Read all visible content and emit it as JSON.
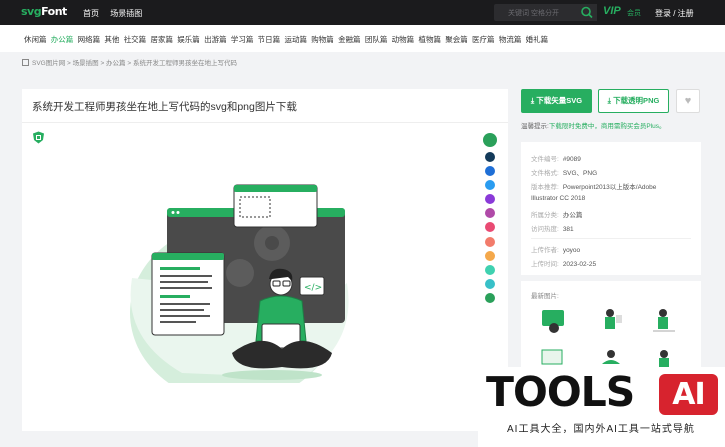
{
  "header": {
    "logo_prefix": "svg",
    "logo_suffix": "Font",
    "nav": [
      "首页",
      "场景插图"
    ],
    "search_placeholder": "关键词 空格分开",
    "vip_label": "VIP",
    "vip_sub": "会员",
    "login_label": "登录 / 注册"
  },
  "categories": {
    "items": [
      "休闲篇",
      "办公篇",
      "网络篇",
      "其他",
      "社交篇",
      "居家篇",
      "娱乐篇",
      "出游篇",
      "学习篇",
      "节日篇",
      "运动篇",
      "购物篇",
      "金融篇",
      "团队篇",
      "动物篇",
      "植物篇",
      "聚会篇",
      "医疗篇",
      "物流篇",
      "婚礼篇"
    ],
    "active_index": 1,
    "accent": "#27ae60"
  },
  "breadcrumb": "SVG图片网 > 场景插图 > 办公篇 > 系统开发工程师男孩坐在地上写代码",
  "main": {
    "title": "系统开发工程师男孩坐在地上写代码的svg和png图片下载",
    "swatches": [
      "#2aa05a",
      "#143a5a",
      "#1f6fd6",
      "#2a9cf0",
      "#8a3ad8",
      "#b04aa8",
      "#e94a73",
      "#f27b6b",
      "#f4a84b",
      "#3fd1b0",
      "#38c0c8",
      "#2aa05a"
    ]
  },
  "sidebar": {
    "download_svg": "下载矢量SVG",
    "download_png": "下载透明PNG",
    "fav_icon": "heart-icon",
    "tip_label": "温馨提示:",
    "tip_text": "下载限时免费中，商用需购买会员Plus。",
    "info": {
      "id_label": "文件编号:",
      "id": "#9089",
      "format_label": "文件格式:",
      "format": "SVG、PNG",
      "version_label": "版本推荐:",
      "version_1": "Powerpoint2013以上版本/Adobe",
      "version_2": "Illustrator CC 2018",
      "category_label": "所属分类:",
      "category": "办公篇",
      "visits_label": "访问热度:",
      "visits": "381",
      "author_label": "上传作者:",
      "author": "yoyoo",
      "date_label": "上传时间:",
      "date": "2023-02-25"
    },
    "latest_title": "最新图片:"
  },
  "watermark": {
    "tools": "TOOLS",
    "ai": "AI",
    "subtitle": "AI工具大全，国内外AI工具一站式导航"
  }
}
